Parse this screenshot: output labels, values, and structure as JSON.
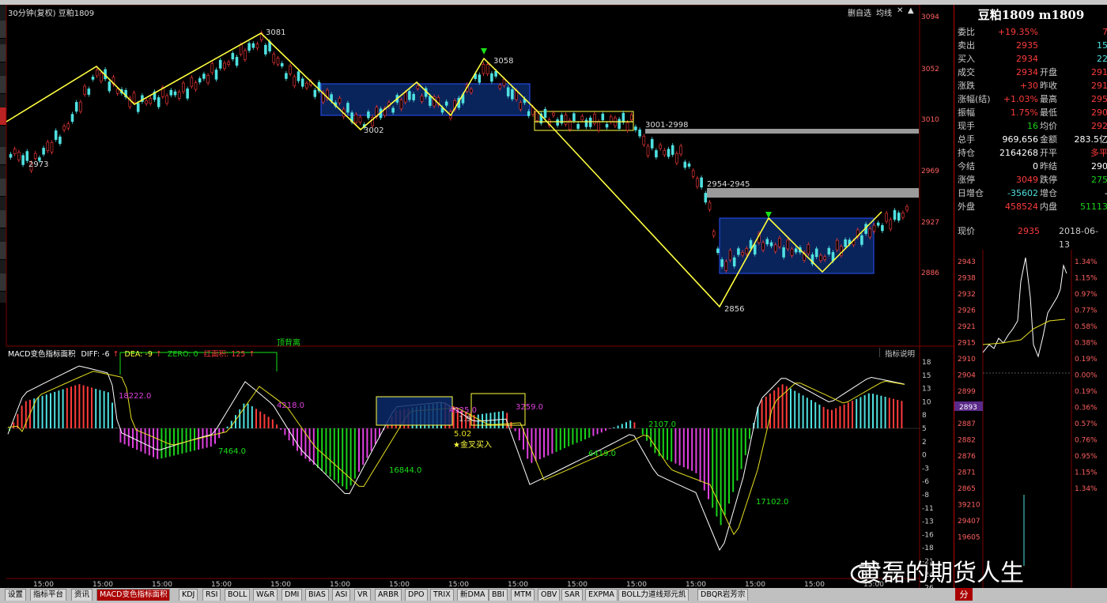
{
  "header": {
    "title": "30分钟(复权) 豆粕1809",
    "toolbar_right": [
      "删自选",
      "均线"
    ]
  },
  "price_axis": {
    "labels": [
      "3094",
      "3052",
      "3010",
      "2969",
      "2927",
      "2886"
    ]
  },
  "annotations": {
    "p_2973": "2973",
    "p_3081": "3081",
    "p_3002": "3002",
    "p_3058": "3058",
    "p_3001_2998": "3001-2998",
    "p_2954_2945": "2954-2945",
    "p_2856": "2856"
  },
  "macd": {
    "title": "MACD变色指标面积",
    "diff_label": "DIFF: -6",
    "dea_label": "DEA: -9",
    "zero_label": "ZERO: 0",
    "area_label": "红面积: 125",
    "hint_button": "指标说明",
    "axis": [
      "18",
      "15",
      "13",
      "10",
      "8",
      "5",
      "2",
      "0",
      "-3",
      "-6",
      "-8",
      "-11",
      "-13",
      "-16",
      "-18",
      "-21",
      "-24",
      "-26"
    ],
    "notes": {
      "top_div": "顶背离",
      "a1": "18222.0",
      "a2": "4218.0",
      "a3": "7464.0",
      "a4": "16844.0",
      "a5": "4925.0",
      "a6": "3259.0",
      "a7": "1.9",
      "a8": "5.02",
      "a9": "2107.0",
      "a10": "6419.0",
      "a11": "17102.0",
      "golden": "★金叉买入"
    },
    "time_labels": [
      "15:00",
      "15:00",
      "15:00",
      "15:00",
      "15:00",
      "15:00",
      "15:00",
      "15:00",
      "15:00",
      "15:00",
      "15:00",
      "15:00",
      "15:00",
      "15:00",
      "15:00"
    ]
  },
  "quote": {
    "title": "豆粕1809 m1809",
    "rows": [
      {
        "l": "委比",
        "v": "+19.35%",
        "vc": "red",
        "l2": "",
        "v2": "7",
        "v2c": "red"
      },
      {
        "l": "卖出",
        "v": "2935",
        "vc": "red",
        "l2": "",
        "v2": "15",
        "v2c": "cyn"
      },
      {
        "l": "买入",
        "v": "2934",
        "vc": "red",
        "l2": "",
        "v2": "22",
        "v2c": "cyn"
      },
      {
        "l": "成交",
        "v": "2934",
        "vc": "red",
        "l2": "开盘",
        "v2": "291",
        "v2c": "red"
      },
      {
        "l": "涨跌",
        "v": "+30",
        "vc": "red",
        "l2": "昨收",
        "v2": "291",
        "v2c": "red"
      },
      {
        "l": "涨幅(结)",
        "v": "+1.03%",
        "vc": "red",
        "l2": "最高",
        "v2": "295",
        "v2c": "red"
      },
      {
        "l": "振幅",
        "v": "1.75%",
        "vc": "red",
        "l2": "最低",
        "v2": "290",
        "v2c": "red"
      },
      {
        "l": "现手",
        "v": "16",
        "vc": "grn",
        "l2": "均价",
        "v2": "292",
        "v2c": "red"
      },
      {
        "l": "总手",
        "v": "969,656",
        "vc": "wht",
        "l2": "金额",
        "v2": "283.5亿",
        "v2c": "wht"
      },
      {
        "l": "持仓",
        "v": "2164268",
        "vc": "wht",
        "l2": "开平",
        "v2": "多平",
        "v2c": "red"
      },
      {
        "l": "今结",
        "v": "0",
        "vc": "wht",
        "l2": "昨结",
        "v2": "290",
        "v2c": "wht"
      },
      {
        "l": "涨停",
        "v": "3049",
        "vc": "red",
        "l2": "跌停",
        "v2": "275",
        "v2c": "grn"
      },
      {
        "l": "日增仓",
        "v": "-35602",
        "vc": "cyn",
        "l2": "增仓",
        "v2": "-",
        "v2c": "wht"
      },
      {
        "l": "外盘",
        "v": "458524",
        "vc": "red",
        "l2": "内盘",
        "v2": "51113",
        "v2c": "grn"
      }
    ],
    "now_label": "现价",
    "now_value": "2935",
    "date": "2018-06-13"
  },
  "mini": {
    "left_axis": [
      "2943",
      "2938",
      "2932",
      "2926",
      "2921",
      "2915",
      "2910",
      "2904",
      "2899",
      "2893",
      "2887",
      "2882",
      "2876",
      "2871",
      "2865",
      "39210",
      "29407",
      "19605"
    ],
    "right_axis": [
      "1.34%",
      "1.15%",
      "0.97%",
      "0.77%",
      "0.58%",
      "0.38%",
      "0.19%",
      "0.00%",
      "0.19%",
      "0.36%",
      "0.57%",
      "0.76%",
      "0.95%",
      "1.15%",
      "1.34%"
    ],
    "badge": "2893"
  },
  "bottom_tabs": [
    "设置",
    "指标平台",
    "资讯",
    "MACD变色指标面积",
    "KDJ",
    "RSI",
    "BOLL",
    "W&R",
    "DMI",
    "BIAS",
    "ASI",
    "VR",
    "ARBR",
    "DPO",
    "TRIX",
    "新DMA",
    "BBI",
    "MTM",
    "OBV",
    "SAR",
    "EXPMA",
    "BOLL力道线郑元凯",
    "DBQR岩芳宗"
  ],
  "watermark": "黄磊的期货人生",
  "mini_tag": "分"
}
